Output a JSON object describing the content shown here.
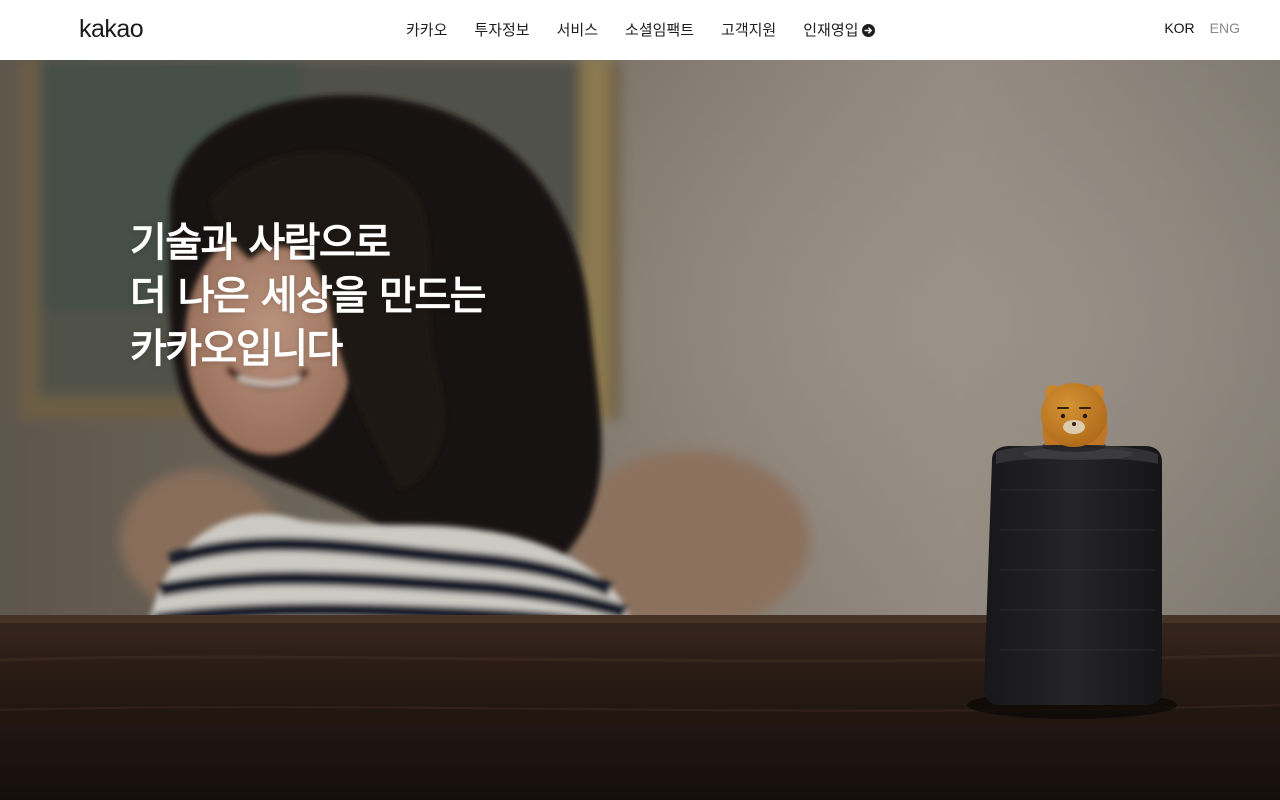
{
  "header": {
    "logo": "kakao",
    "nav": [
      {
        "label": "카카오"
      },
      {
        "label": "투자정보"
      },
      {
        "label": "서비스"
      },
      {
        "label": "소셜임팩트"
      },
      {
        "label": "고객지원"
      },
      {
        "label": "인재영입",
        "icon": "external-arrow-icon"
      }
    ],
    "lang": {
      "kor": "KOR",
      "eng": "ENG",
      "active": "KOR"
    }
  },
  "hero": {
    "lines": [
      "기술과 사람으로",
      "더 나은 세상을 만드는",
      "카카오입니다"
    ],
    "image_description_icons": [
      "child-photo",
      "smart-speaker",
      "ryan-character-figure"
    ]
  },
  "colors": {
    "header_bg": "#ffffff",
    "text_dark": "#1e1e1e",
    "lang_inactive": "#8a8a8a",
    "headline": "#ffffff"
  }
}
